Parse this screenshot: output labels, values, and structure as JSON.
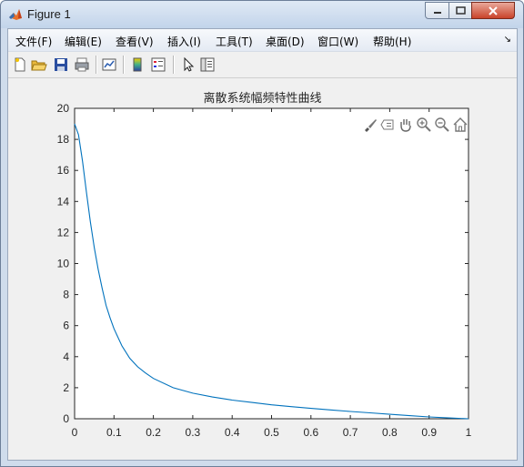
{
  "window": {
    "title": "Figure 1",
    "controls": {
      "minimize": "–",
      "maximize": "□",
      "close": "✕"
    }
  },
  "menubar": {
    "items": [
      {
        "label": "文件(F)"
      },
      {
        "label": "编辑(E)"
      },
      {
        "label": "查看(V)"
      },
      {
        "label": "插入(I)"
      },
      {
        "label": "工具(T)"
      },
      {
        "label": "桌面(D)"
      },
      {
        "label": "窗口(W)"
      },
      {
        "label": "帮助(H)"
      }
    ],
    "overflow_icon": "dock-arrow-icon"
  },
  "toolbar": {
    "icons": [
      "new-figure-icon",
      "open-file-icon",
      "save-icon",
      "print-icon",
      "link-plot-icon",
      "insert-colorbar-icon",
      "insert-legend-icon",
      "edit-plot-icon",
      "property-inspector-icon"
    ]
  },
  "axes_toolbar": {
    "icons": [
      "brush-icon",
      "data-tips-icon",
      "pan-icon",
      "zoom-in-icon",
      "zoom-out-icon",
      "home-icon"
    ]
  },
  "colors": {
    "line": "#0072bd",
    "axes_bg": "#ffffff",
    "figure_bg": "#f0f0f0",
    "axis": "#262626"
  },
  "chart_data": {
    "type": "line",
    "title": "离散系统幅频特性曲线",
    "xlabel": "",
    "ylabel": "",
    "xlim": [
      0,
      1
    ],
    "ylim": [
      0,
      20
    ],
    "xticks": [
      "0",
      "0.1",
      "0.2",
      "0.3",
      "0.4",
      "0.5",
      "0.6",
      "0.7",
      "0.8",
      "0.9",
      "1"
    ],
    "yticks": [
      "0",
      "2",
      "4",
      "6",
      "8",
      "10",
      "12",
      "14",
      "16",
      "18",
      "20"
    ],
    "grid": false,
    "series": [
      {
        "x": [
          0,
          0.01,
          0.02,
          0.03,
          0.04,
          0.05,
          0.06,
          0.07,
          0.08,
          0.09,
          0.1,
          0.12,
          0.14,
          0.16,
          0.18,
          0.2,
          0.25,
          0.3,
          0.35,
          0.4,
          0.45,
          0.5,
          0.55,
          0.6,
          0.65,
          0.7,
          0.75,
          0.8,
          0.85,
          0.9,
          0.95,
          1.0
        ],
        "y": [
          19.0,
          18.3,
          16.6,
          14.6,
          12.7,
          11.0,
          9.6,
          8.4,
          7.3,
          6.5,
          5.8,
          4.7,
          3.9,
          3.35,
          2.95,
          2.6,
          2.0,
          1.65,
          1.4,
          1.2,
          1.05,
          0.9,
          0.78,
          0.67,
          0.57,
          0.47,
          0.38,
          0.29,
          0.2,
          0.12,
          0.05,
          0.0
        ]
      }
    ]
  }
}
